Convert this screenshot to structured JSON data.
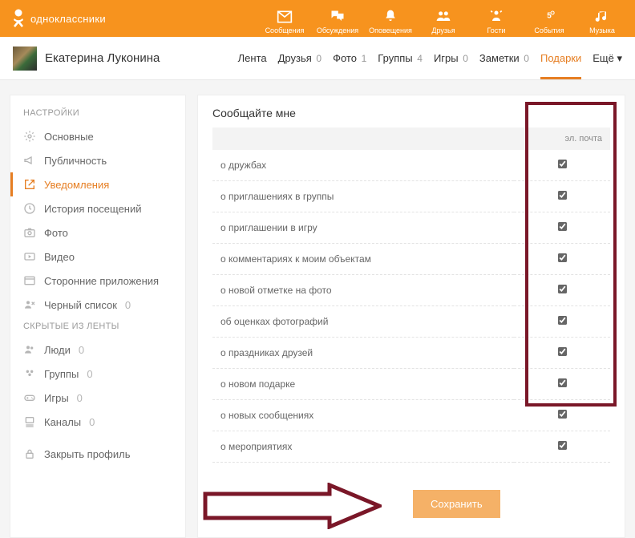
{
  "brand": {
    "name": "одноклассники"
  },
  "topnav": [
    {
      "key": "messages",
      "label": "Сообщения",
      "icon": "mail"
    },
    {
      "key": "discuss",
      "label": "Обсуждения",
      "icon": "chat"
    },
    {
      "key": "notify",
      "label": "Оповещения",
      "icon": "bell"
    },
    {
      "key": "friends",
      "label": "Друзья",
      "icon": "friends"
    },
    {
      "key": "guests",
      "label": "Гости",
      "icon": "guests"
    },
    {
      "key": "events",
      "label": "События",
      "icon": "events"
    },
    {
      "key": "music",
      "label": "Музыка",
      "icon": "music"
    }
  ],
  "user": {
    "name": "Екатерина Луконина"
  },
  "tabs": [
    {
      "label": "Лента",
      "count": null
    },
    {
      "label": "Друзья",
      "count": "0"
    },
    {
      "label": "Фото",
      "count": "1"
    },
    {
      "label": "Группы",
      "count": "4"
    },
    {
      "label": "Игры",
      "count": "0"
    },
    {
      "label": "Заметки",
      "count": "0"
    },
    {
      "label": "Подарки",
      "count": null,
      "active": true
    },
    {
      "label": "Ещё ▾",
      "count": null
    }
  ],
  "sidebar": {
    "heading_settings": "НАСТРОЙКИ",
    "heading_hidden": "СКРЫТЫЕ ИЗ ЛЕНТЫ",
    "items_settings": [
      {
        "label": "Основные",
        "icon": "gear"
      },
      {
        "label": "Публичность",
        "icon": "horn"
      },
      {
        "label": "Уведомления",
        "icon": "share",
        "active": true
      },
      {
        "label": "История посещений",
        "icon": "clock"
      },
      {
        "label": "Фото",
        "icon": "camera"
      },
      {
        "label": "Видео",
        "icon": "video"
      },
      {
        "label": "Сторонние приложения",
        "icon": "window"
      },
      {
        "label": "Черный список",
        "icon": "blacklist",
        "count": "0"
      }
    ],
    "items_hidden": [
      {
        "label": "Люди",
        "icon": "people",
        "count": "0"
      },
      {
        "label": "Группы",
        "icon": "groups",
        "count": "0"
      },
      {
        "label": "Игры",
        "icon": "games",
        "count": "0"
      },
      {
        "label": "Каналы",
        "icon": "channels",
        "count": "0"
      }
    ],
    "close_profile": {
      "label": "Закрыть профиль",
      "icon": "lock"
    }
  },
  "panel": {
    "title": "Сообщайте мне",
    "column_email": "эл. почта",
    "rows": [
      {
        "label": "о дружбах",
        "checked": true
      },
      {
        "label": "о приглашениях в группы",
        "checked": true
      },
      {
        "label": "о приглашении в игру",
        "checked": true
      },
      {
        "label": "о комментариях к моим объектам",
        "checked": true
      },
      {
        "label": "о новой отметке на фото",
        "checked": true
      },
      {
        "label": "об оценках фотографий",
        "checked": true
      },
      {
        "label": "о праздниках друзей",
        "checked": true
      },
      {
        "label": "о новом подарке",
        "checked": true
      },
      {
        "label": "о новых сообщениях",
        "checked": true
      },
      {
        "label": "о мероприятиях",
        "checked": true
      }
    ],
    "save_label": "Сохранить"
  }
}
